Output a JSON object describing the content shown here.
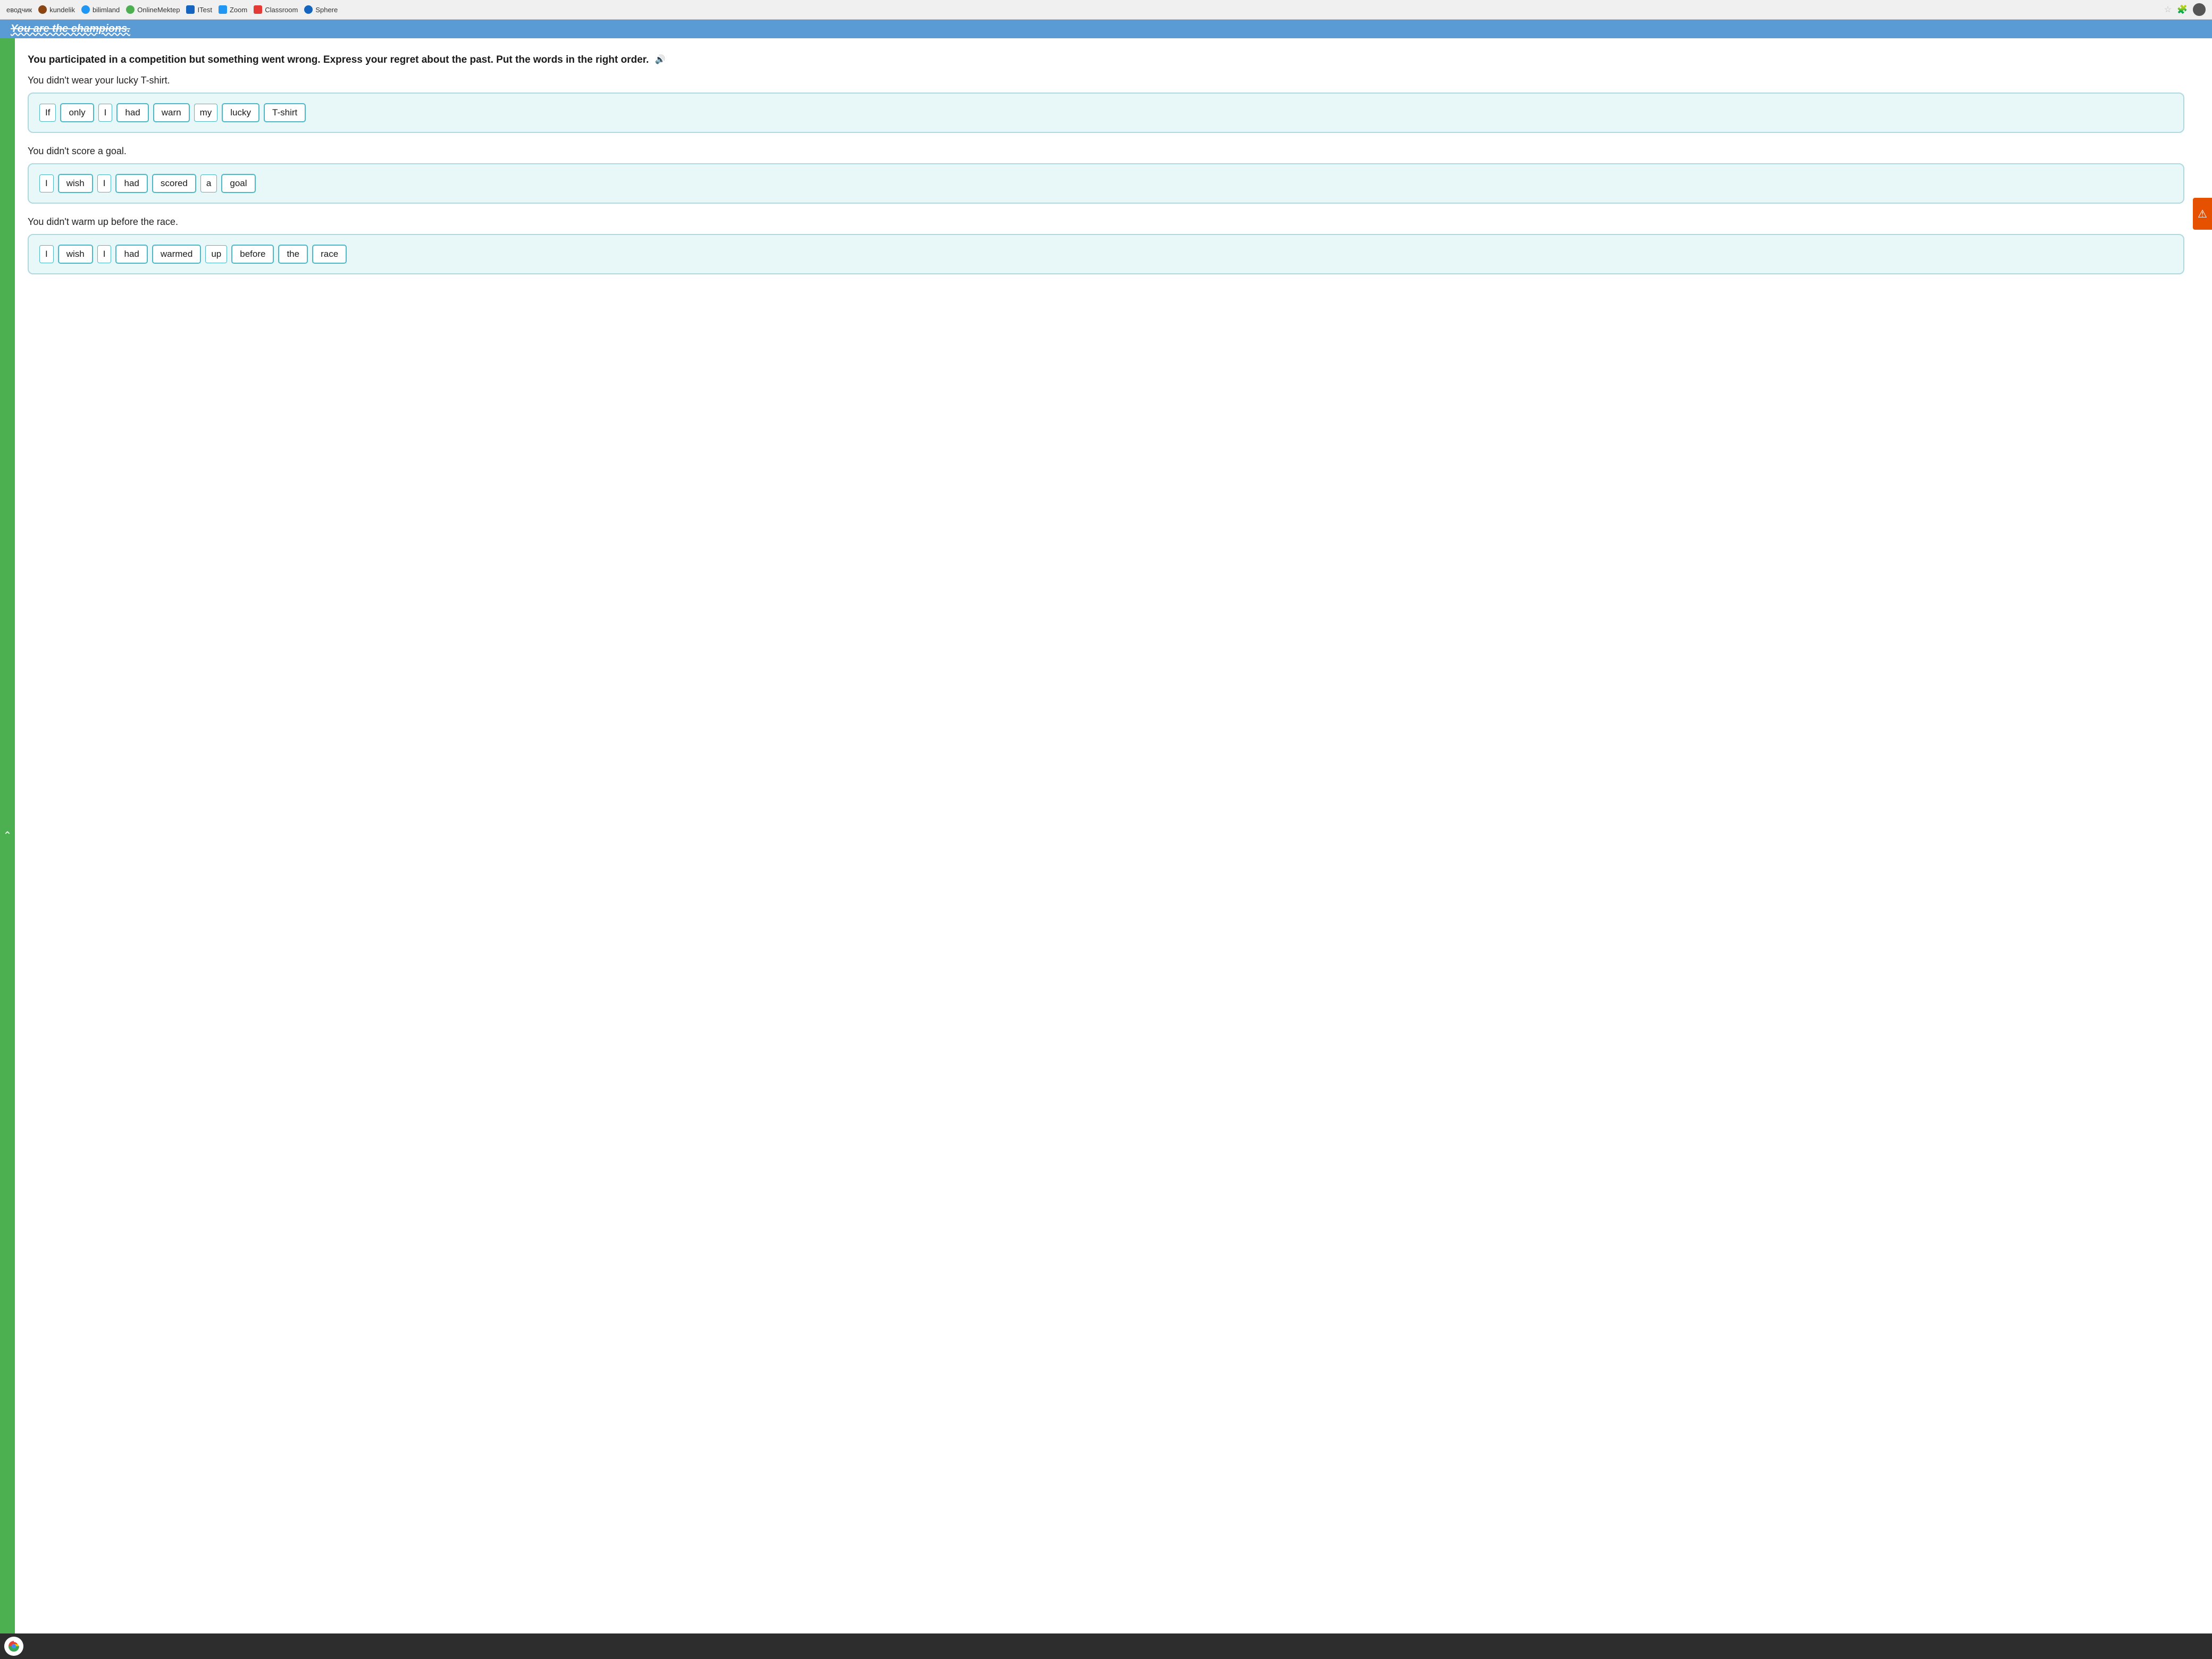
{
  "browser": {
    "tabs": [
      {
        "id": "evodchik",
        "label": "еводчик"
      },
      {
        "id": "kundelik",
        "label": "kundelik"
      },
      {
        "id": "bilimland",
        "label": "bilimland"
      },
      {
        "id": "online",
        "label": "OnlineMektep"
      },
      {
        "id": "itest",
        "label": "ITest"
      },
      {
        "id": "zoom",
        "label": "Zoom"
      },
      {
        "id": "classroom",
        "label": "Classroom"
      },
      {
        "id": "sphere",
        "label": "Sphere"
      }
    ]
  },
  "header": {
    "partial_text": "You are the champions."
  },
  "instructions": {
    "text": "You participated in a competition but something went wrong. Express your regret about the past. Put the words in the right order.",
    "audio_label": "audio"
  },
  "exercises": [
    {
      "id": "ex1",
      "prompt": "You didn't wear your lucky T-shirt.",
      "words": [
        "If",
        "only",
        "I",
        "had",
        "warn",
        "my",
        "lucky",
        "T-shirt"
      ]
    },
    {
      "id": "ex2",
      "prompt": "You didn't score a goal.",
      "words": [
        "I",
        "wish",
        "I",
        "had",
        "scored",
        "a",
        "goal"
      ]
    },
    {
      "id": "ex3",
      "prompt": "You didn't warm up before the race.",
      "words": [
        "I",
        "wish",
        "I",
        "had",
        "warmed",
        "up",
        "before",
        "the",
        "race"
      ]
    }
  ]
}
